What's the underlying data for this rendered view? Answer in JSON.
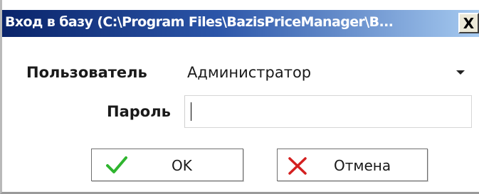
{
  "window": {
    "title": "Вход в базу (C:\\Program Files\\BazisPriceManager\\B...",
    "close_glyph": "X"
  },
  "form": {
    "user_label": "Пользователь",
    "user_value": "Администратор",
    "password_label": "Пароль",
    "password_value": ""
  },
  "buttons": {
    "ok_label": "OK",
    "ok_icon": "checkmark-icon",
    "cancel_label": "Отмена",
    "cancel_icon": "cross-icon"
  },
  "colors": {
    "title_gradient_start": "#0a246a",
    "title_gradient_end": "#a6caf0",
    "ok_icon": "#2fb52f",
    "cancel_icon": "#d42020"
  }
}
